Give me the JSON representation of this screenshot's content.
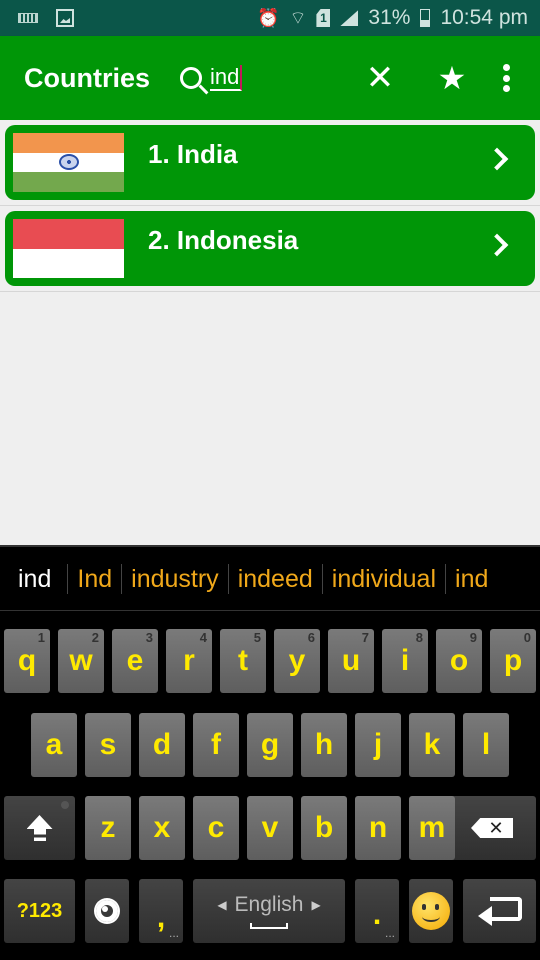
{
  "status_bar": {
    "battery_percent": "31%",
    "time": "10:54 pm",
    "sim_label": "1",
    "icons": [
      "keyboard-icon",
      "image-icon",
      "alarm-icon",
      "wifi-icon",
      "sim-icon",
      "signal-icon",
      "battery-icon"
    ]
  },
  "app_bar": {
    "title": "Countries",
    "search_value": "ind",
    "clear_icon": "✕",
    "star_icon": "★"
  },
  "countries": [
    {
      "label": "1. India",
      "flag": "india-flag"
    },
    {
      "label": "2. Indonesia",
      "flag": "indonesia-flag"
    }
  ],
  "keyboard": {
    "suggestions": [
      "ind",
      "Ind",
      "industry",
      "indeed",
      "individual",
      "ind"
    ],
    "row1": [
      {
        "key": "q",
        "hint": "1"
      },
      {
        "key": "w",
        "hint": "2"
      },
      {
        "key": "e",
        "hint": "3"
      },
      {
        "key": "r",
        "hint": "4"
      },
      {
        "key": "t",
        "hint": "5"
      },
      {
        "key": "y",
        "hint": "6"
      },
      {
        "key": "u",
        "hint": "7"
      },
      {
        "key": "i",
        "hint": "8"
      },
      {
        "key": "o",
        "hint": "9"
      },
      {
        "key": "p",
        "hint": "0"
      }
    ],
    "row2": [
      "a",
      "s",
      "d",
      "f",
      "g",
      "h",
      "j",
      "k",
      "l"
    ],
    "row3": [
      "z",
      "x",
      "c",
      "v",
      "b",
      "n",
      "m"
    ],
    "symbols_label": "?123",
    "comma": ",",
    "period": ".",
    "more_dots": "...",
    "language": "English",
    "backspace_glyph": "✕",
    "lang_prev": "◀",
    "lang_next": "▶"
  }
}
